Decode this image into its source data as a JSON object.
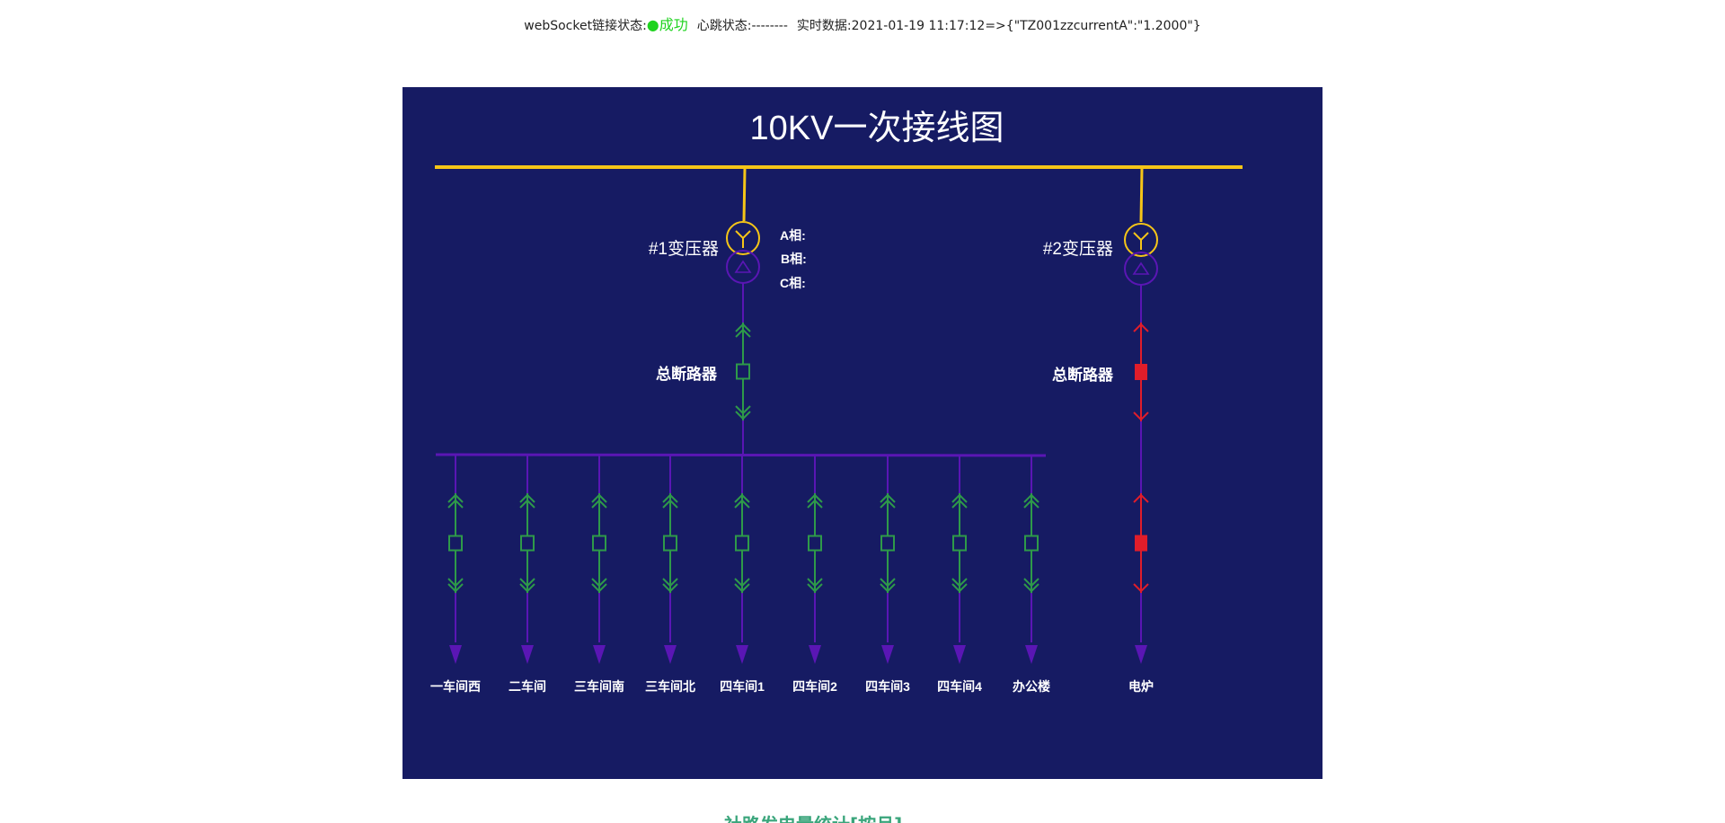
{
  "status": {
    "ws_label": "webSocket链接状态:",
    "ws_indicator": "●",
    "ws_state": "成功",
    "heartbeat_label": "心跳状态:--------",
    "realtime_label": "实时数据:2021-01-19 11:17:12=>{\"TZ001zzcurrentA\":\"1.2000\"}"
  },
  "diagram": {
    "title": "10KV一次接线图",
    "transformer1": {
      "label": "#1变压器",
      "phase_a": "A相:",
      "phase_b": "B相:",
      "phase_c": "C相:"
    },
    "transformer2": {
      "label": "#2变压器"
    },
    "breaker1_label": "总断路器",
    "breaker2_label": "总断路器",
    "feeders": [
      {
        "name": "一车间西",
        "state": "open"
      },
      {
        "name": "二车间",
        "state": "open"
      },
      {
        "name": "三车间南",
        "state": "open"
      },
      {
        "name": "三车间北",
        "state": "open"
      },
      {
        "name": "四车间1",
        "state": "open"
      },
      {
        "name": "四车间2",
        "state": "open"
      },
      {
        "name": "四车间3",
        "state": "open"
      },
      {
        "name": "四车间4",
        "state": "open"
      },
      {
        "name": "办公楼",
        "state": "open"
      }
    ],
    "right_feeder": {
      "name": "电炉",
      "state": "closed"
    },
    "breaker1_state": "open",
    "breaker2_state": "closed",
    "colors": {
      "background": "#161b63",
      "main_bus": "#f5c518",
      "bus_10kv": "#5a16b4",
      "breaker_open": "#2e9a49",
      "breaker_closed": "#e01d2a",
      "text": "#ffffff"
    }
  },
  "footer_partial": "社路发电量统计[按月]"
}
